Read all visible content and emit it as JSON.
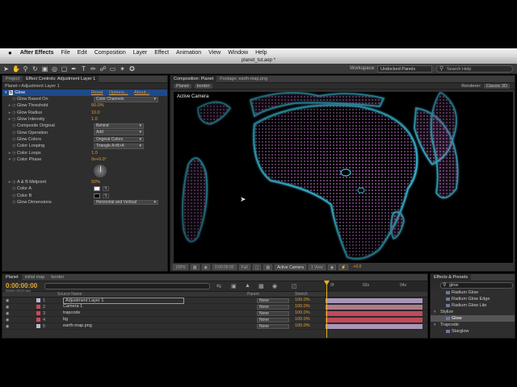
{
  "menubar": {
    "apple": "",
    "app": "After Effects",
    "items": [
      "File",
      "Edit",
      "Composition",
      "Layer",
      "Effect",
      "Animation",
      "View",
      "Window",
      "Help"
    ]
  },
  "window_title": "planet_tut.aep *",
  "toolbar": {
    "workspace_label": "Workspace:",
    "workspace_value": "Undocked Panels",
    "search_placeholder": "Search Help"
  },
  "effect_controls": {
    "tabs": [
      "Project",
      "Effect Controls: Adjustment Layer 1"
    ],
    "subheader": "Planet • Adjustment Layer 1",
    "effect_name": "Glow",
    "links": [
      "Reset",
      "Options...",
      "About..."
    ],
    "properties": [
      {
        "name": "Glow Based On",
        "value": "Color Channels",
        "kind": "dropdown"
      },
      {
        "name": "Glow Threshold",
        "value": "60.0%",
        "kind": "value"
      },
      {
        "name": "Glow Radius",
        "value": "10.0",
        "kind": "value"
      },
      {
        "name": "Glow Intensity",
        "value": "1.0",
        "kind": "value"
      },
      {
        "name": "Composite Original",
        "value": "Behind",
        "kind": "dropdown"
      },
      {
        "name": "Glow Operation",
        "value": "Add",
        "kind": "dropdown"
      },
      {
        "name": "Glow Colors",
        "value": "Original Colors",
        "kind": "dropdown"
      },
      {
        "name": "Color Looping",
        "value": "Triangle A>B>A",
        "kind": "dropdown"
      },
      {
        "name": "Color Loops",
        "value": "1.0",
        "kind": "value"
      },
      {
        "name": "Color Phase",
        "value": "0x+0.0°",
        "kind": "value"
      },
      {
        "name": "A & B Midpoint",
        "value": "50%",
        "kind": "value"
      },
      {
        "name": "Color A",
        "value": "",
        "kind": "color"
      },
      {
        "name": "Color B",
        "value": "",
        "kind": "color"
      },
      {
        "name": "Glow Dimensions",
        "value": "Horizontal and Vertical",
        "kind": "dropdown"
      }
    ]
  },
  "composition": {
    "tabs": [
      "Composition: Planet",
      "Footage: earth-map.png"
    ],
    "sub_tabs": [
      "Planet",
      "border"
    ],
    "renderer_label": "Renderer:",
    "renderer_value": "Classic 3D",
    "active_camera": "Active Camera",
    "controls": [
      "100%",
      "0:00:00:00",
      "Full",
      "Active Camera",
      "1 View"
    ],
    "exposure": "+0.0"
  },
  "timeline": {
    "tabs": [
      "Planet",
      "initial map",
      "border"
    ],
    "timecode": "0:00:00:00",
    "fps": "00000 (25.00 fps)",
    "columns": [
      "Source Name",
      "Parent",
      "Stretch"
    ],
    "ruler": [
      "0f",
      "02s",
      "04s"
    ],
    "layers": [
      {
        "index": "1",
        "name": "Adjustment Layer 1",
        "parent": "None",
        "stretch": "100.0%",
        "label_color": "#b8b8d8",
        "bar_color": "#a896b8"
      },
      {
        "index": "2",
        "name": "Camera 1",
        "parent": "None",
        "stretch": "100.0%",
        "label_color": "#c84a5a",
        "bar_color": "#b07a8a"
      },
      {
        "index": "3",
        "name": "trapcode",
        "parent": "None",
        "stretch": "100.0%",
        "label_color": "#c84a5a",
        "bar_color": "#c04a5a"
      },
      {
        "index": "4",
        "name": "bg",
        "parent": "None",
        "stretch": "100.0%",
        "label_color": "#c84a5a",
        "bar_color": "#c04a5a"
      },
      {
        "index": "5",
        "name": "earth-map.png",
        "parent": "None",
        "stretch": "100.0%",
        "label_color": "#b8b8d8",
        "bar_color": "#a896b8"
      }
    ]
  },
  "effects_presets": {
    "title": "Effects & Presets",
    "search_value": "glow",
    "items": [
      {
        "type": "item",
        "label": "Radium Glow"
      },
      {
        "type": "item",
        "label": "Radium Glow Edge"
      },
      {
        "type": "item",
        "label": "Radium Glow Lite"
      },
      {
        "type": "category",
        "label": "Stylize"
      },
      {
        "type": "item",
        "label": "Glow",
        "selected": true
      },
      {
        "type": "category",
        "label": "Trapcode"
      },
      {
        "type": "item",
        "label": "Starglow"
      }
    ]
  },
  "colors": {
    "accent_orange": "#e89a2c",
    "timecode_yellow": "#e8a92c",
    "selection_blue": "#1f4a8a",
    "globe_land": "#c070c8",
    "globe_coast": "#3ec8e8"
  }
}
